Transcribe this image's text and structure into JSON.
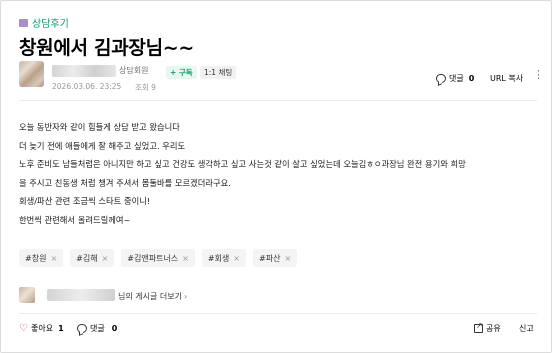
{
  "board": {
    "name": "상담후기"
  },
  "post": {
    "title": "창원에서 김과장님~~",
    "author": {
      "member_level": "상담회원",
      "follow_label": "+ 구독",
      "chat_label": "1:1 채팅"
    },
    "date": "2026.03.06. 23:25",
    "views": "조회 9",
    "top_comment_label": "댓글",
    "top_comment_count": "0",
    "url_copy_label": "URL 복사",
    "more_menu": "⋮",
    "content_lines": [
      "오늘 동반자와 같이 힘들게 상담 받고 왔습니다",
      "더 늦기 전에 애들에게 잘 해주고 싶었고. 우리도",
      "노후 준비도 남들처럼은 아니지만 하고 싶고 건강도 생각하고 싶고 사는것 같이 살고 싶었는데 오늘김ㅎㅇ과장님 완전 용기와 희망",
      "을 주시고 친동생 처럼 챙겨 주셔서 몸둘바를 모르겠더라구요.",
      "회생/파산 관련 조금씩 스타트 중이니!",
      "한번씩 관련해서 올려드릴께여~"
    ],
    "tags": [
      "#창원",
      "#김해",
      "#김앤파트너스",
      "#회생",
      "#파산"
    ],
    "tag_remove_symbol": "×"
  },
  "more_posts": {
    "label": "님의 게시글 더보기",
    "chevron": "›"
  },
  "footer": {
    "like_label": "좋아요",
    "like_count": "1",
    "comment_label": "댓글",
    "comment_count": "0",
    "share_label": "공유",
    "report_label": "신고"
  },
  "colors": {
    "accent_green": "#0a9e6a",
    "like_red": "#e04040",
    "board_icon": "#a98ec9"
  }
}
